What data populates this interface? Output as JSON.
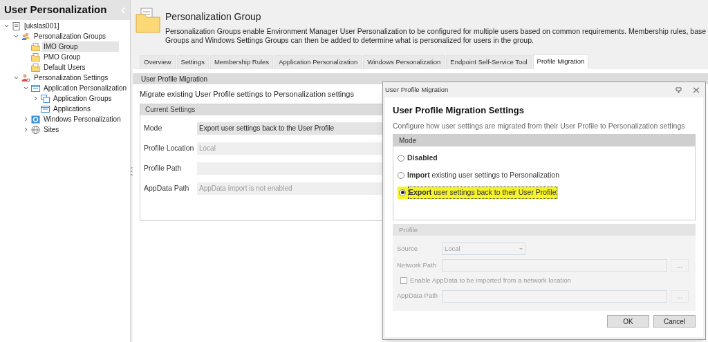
{
  "sidebar": {
    "title": "User Personalization",
    "tree": [
      {
        "label": "[ukslas001]",
        "kind": "server",
        "expanded": true,
        "selected": false,
        "children": [
          {
            "label": "Personalization Groups",
            "kind": "group",
            "expanded": true,
            "selected": false,
            "children": [
              {
                "label": "IMO Group",
                "kind": "folder",
                "selected": true
              },
              {
                "label": "PMO Group",
                "kind": "folder",
                "selected": false
              },
              {
                "label": "Default Users",
                "kind": "folder",
                "selected": false
              }
            ]
          },
          {
            "label": "Personalization Settings",
            "kind": "user-settings",
            "expanded": true,
            "selected": false,
            "children": [
              {
                "label": "Application Personalization",
                "kind": "window",
                "expanded": true,
                "selected": false,
                "children": [
                  {
                    "label": "Application Groups",
                    "kind": "windows-stack",
                    "expanded": false,
                    "selected": false
                  },
                  {
                    "label": "Applications",
                    "kind": "window",
                    "selected": false
                  }
                ]
              },
              {
                "label": "Windows Personalization",
                "kind": "gear",
                "expanded": false,
                "selected": false
              },
              {
                "label": "Sites",
                "kind": "globe",
                "expanded": false,
                "selected": false
              }
            ]
          }
        ]
      }
    ]
  },
  "header": {
    "title": "Personalization Group",
    "description_lines": [
      "Personalization Groups enable Environment Manager User Personalization to be configured for multiple users based on common requirements. Membership rules, base",
      "Groups and Windows Settings Groups can then be added to determine what is personalized for users in the group."
    ]
  },
  "tabs": [
    {
      "label": "Overview",
      "selected": false
    },
    {
      "label": "Settings",
      "selected": false
    },
    {
      "label": "Membership Rules",
      "selected": false
    },
    {
      "label": "Application Personalization",
      "selected": false
    },
    {
      "label": "Windows Personalization",
      "selected": false
    },
    {
      "label": "Endpoint Self-Service Tool",
      "selected": false
    },
    {
      "label": "Profile Migration",
      "selected": true
    }
  ],
  "panel": {
    "title": "User Profile Migration",
    "intro": "Migrate existing User Profile settings to Personalization settings",
    "group_title": "Current Settings",
    "rows": [
      {
        "label": "Mode",
        "value": "Export user settings back to the User Profile",
        "disabled": false
      },
      {
        "label": "Profile Location",
        "value": "Local",
        "disabled": true
      },
      {
        "label": "Profile Path",
        "disabled": true
      },
      {
        "label": "AppData Path",
        "value": "AppData import is not enabled",
        "disabled": true
      }
    ]
  },
  "dialog": {
    "title": "User Profile Migration",
    "heading": "User Profile Migration Settings",
    "subtitle": "Configure how user settings are migrated from their User Profile to Personalization settings",
    "mode": {
      "title": "Mode",
      "options": [
        {
          "label": "**Disabled**",
          "selected": false,
          "highlighted": false
        },
        {
          "label": "**Import** existing user settings to Personalization",
          "selected": false,
          "highlighted": false
        },
        {
          "label": "**Export** user settings back to their User Profile",
          "selected": true,
          "highlighted": true
        }
      ]
    },
    "profile": {
      "title": "Profile",
      "disabled": true,
      "source": {
        "label": "Source",
        "value": "Local"
      },
      "network_path": {
        "label": "Network Path",
        "browse": "..."
      },
      "appdata_checkbox": {
        "label": "Enable AppData to be imported from a network location",
        "checked": false
      },
      "appdata_path": {
        "label": "AppData Path",
        "browse": "..."
      }
    },
    "buttons": [
      "OK",
      "Cancel"
    ]
  }
}
